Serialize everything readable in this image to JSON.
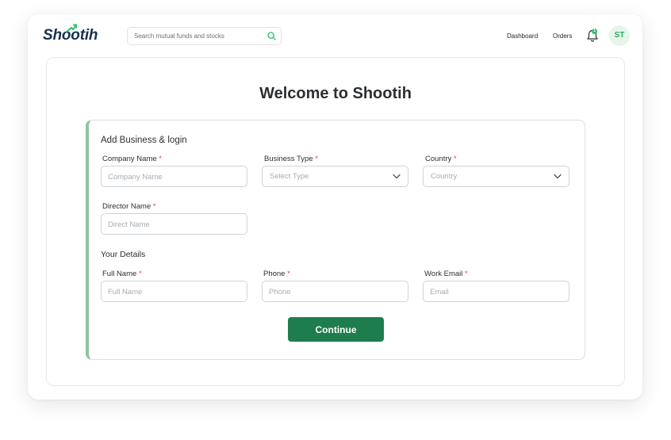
{
  "header": {
    "logo_text": "Shootih",
    "search_placeholder": "Search mutual funds and stocks",
    "nav": [
      "Dashboard",
      "Orders"
    ],
    "notification_count": "1",
    "avatar_initials": "ST"
  },
  "main": {
    "title": "Welcome to Shootih",
    "business_section": {
      "title": "Add Business & login",
      "company_name": {
        "label": "Company Name",
        "placeholder": "Company Name"
      },
      "business_type": {
        "label": "Business Type",
        "placeholder": "Select Type"
      },
      "country": {
        "label": "Country",
        "placeholder": "Country"
      },
      "director_name": {
        "label": "Director Name",
        "placeholder": "Direct Name"
      }
    },
    "details_section": {
      "title": "Your Details",
      "full_name": {
        "label": "Full Name",
        "placeholder": "Full Name"
      },
      "phone": {
        "label": "Phone",
        "placeholder": "Phone"
      },
      "work_email": {
        "label": "Work Email",
        "placeholder": "Email"
      }
    },
    "required_marker": "*",
    "continue_label": "Continue"
  },
  "colors": {
    "primary": "#1e7d4c",
    "accent": "#2fbf6f",
    "card_border_accent": "#8fc3a3",
    "required": "#e0443e",
    "logo": "#17324d"
  },
  "icons": [
    "logo-arrow-icon",
    "search-icon",
    "bell-icon",
    "chevron-down-icon"
  ]
}
